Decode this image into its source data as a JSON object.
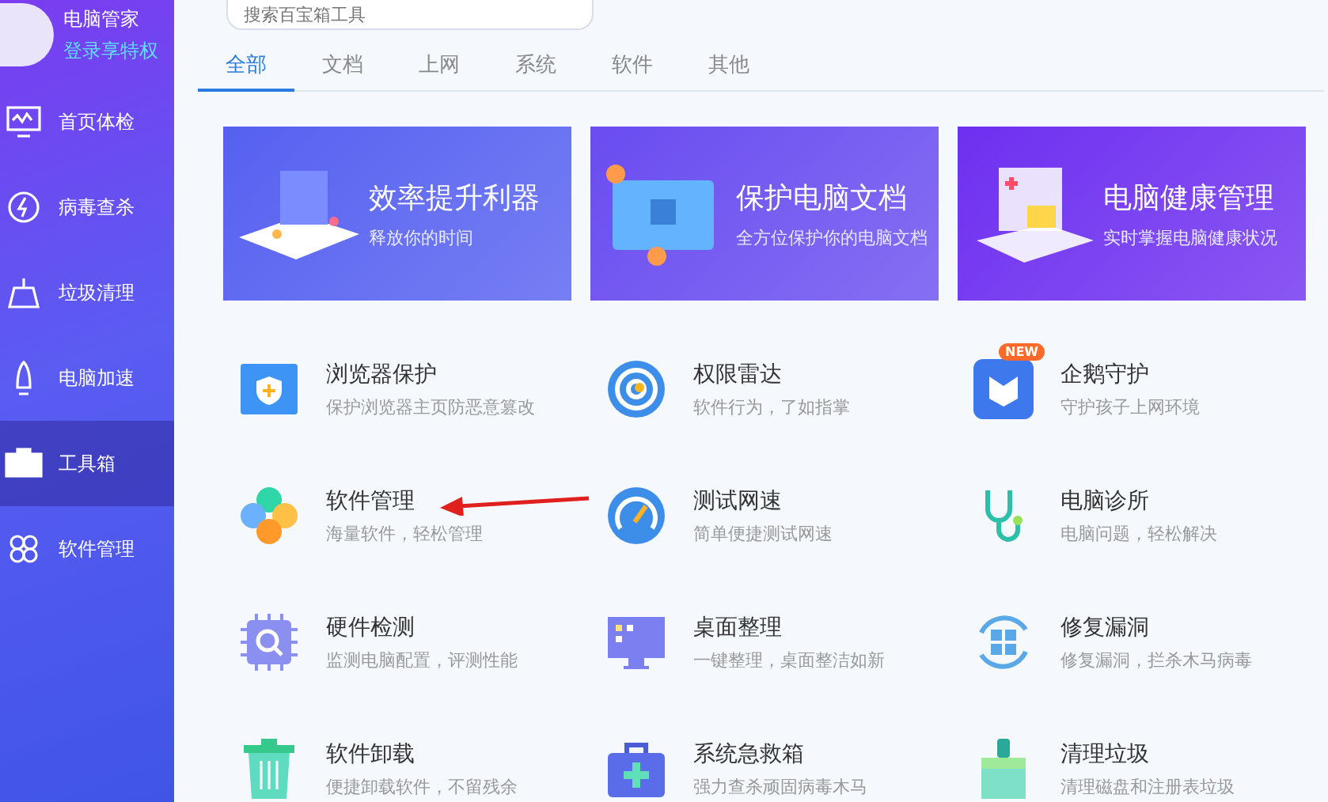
{
  "user": {
    "name": "电脑管家",
    "login_link": "登录享特权"
  },
  "nav": [
    {
      "kind": "monitor",
      "label": "首页体检",
      "selected": false
    },
    {
      "kind": "bolt",
      "label": "病毒查杀",
      "selected": false
    },
    {
      "kind": "broom",
      "label": "垃圾清理",
      "selected": false
    },
    {
      "kind": "rocket",
      "label": "电脑加速",
      "selected": false
    },
    {
      "kind": "toolbox",
      "label": "工具箱",
      "selected": true
    },
    {
      "kind": "apps",
      "label": "软件管理",
      "selected": false
    }
  ],
  "search": {
    "placeholder": "搜索百宝箱工具"
  },
  "tabs": [
    {
      "label": "全部",
      "selected": true
    },
    {
      "label": "文档",
      "selected": false
    },
    {
      "label": "上网",
      "selected": false
    },
    {
      "label": "系统",
      "selected": false
    },
    {
      "label": "软件",
      "selected": false
    },
    {
      "label": "其他",
      "selected": false
    }
  ],
  "banners": [
    {
      "kind": "board",
      "title": "效率提升利器",
      "subtitle": "释放你的时间",
      "color": "#5660f0"
    },
    {
      "kind": "folder",
      "title": "保护电脑文档",
      "subtitle": "全方位保护你的电脑文档",
      "color": "#6a4cf0"
    },
    {
      "kind": "report",
      "title": "电脑健康管理",
      "subtitle": "实时掌握电脑健康状况",
      "color": "#6e2ff0"
    }
  ],
  "tools": [
    {
      "kind": "browser",
      "title": "浏览器保护",
      "description": "保护浏览器主页防恶意篡改"
    },
    {
      "kind": "radar",
      "title": "权限雷达",
      "description": "软件行为，了如指掌"
    },
    {
      "kind": "mshield",
      "title": "企鹅守护",
      "description": "守护孩子上网环境",
      "badge": "NEW"
    },
    {
      "kind": "clover",
      "title": "软件管理",
      "description": "海量软件，轻松管理"
    },
    {
      "kind": "gauge",
      "title": "测试网速",
      "description": "简单便捷测试网速"
    },
    {
      "kind": "stetho",
      "title": "电脑诊所",
      "description": "电脑问题，轻松解决"
    },
    {
      "kind": "chip",
      "title": "硬件检测",
      "description": "监测电脑配置，评测性能"
    },
    {
      "kind": "screen",
      "title": "桌面整理",
      "description": "一键整理，桌面整洁如新"
    },
    {
      "kind": "repair",
      "title": "修复漏洞",
      "description": "修复漏洞，拦杀木马病毒"
    },
    {
      "kind": "trash",
      "title": "软件卸载",
      "description": "便捷卸载软件，不留残余"
    },
    {
      "kind": "medkit",
      "title": "系统急救箱",
      "description": "强力查杀顽固病毒木马"
    },
    {
      "kind": "brush",
      "title": "清理垃圾",
      "description": "清理磁盘和注册表垃圾"
    }
  ]
}
